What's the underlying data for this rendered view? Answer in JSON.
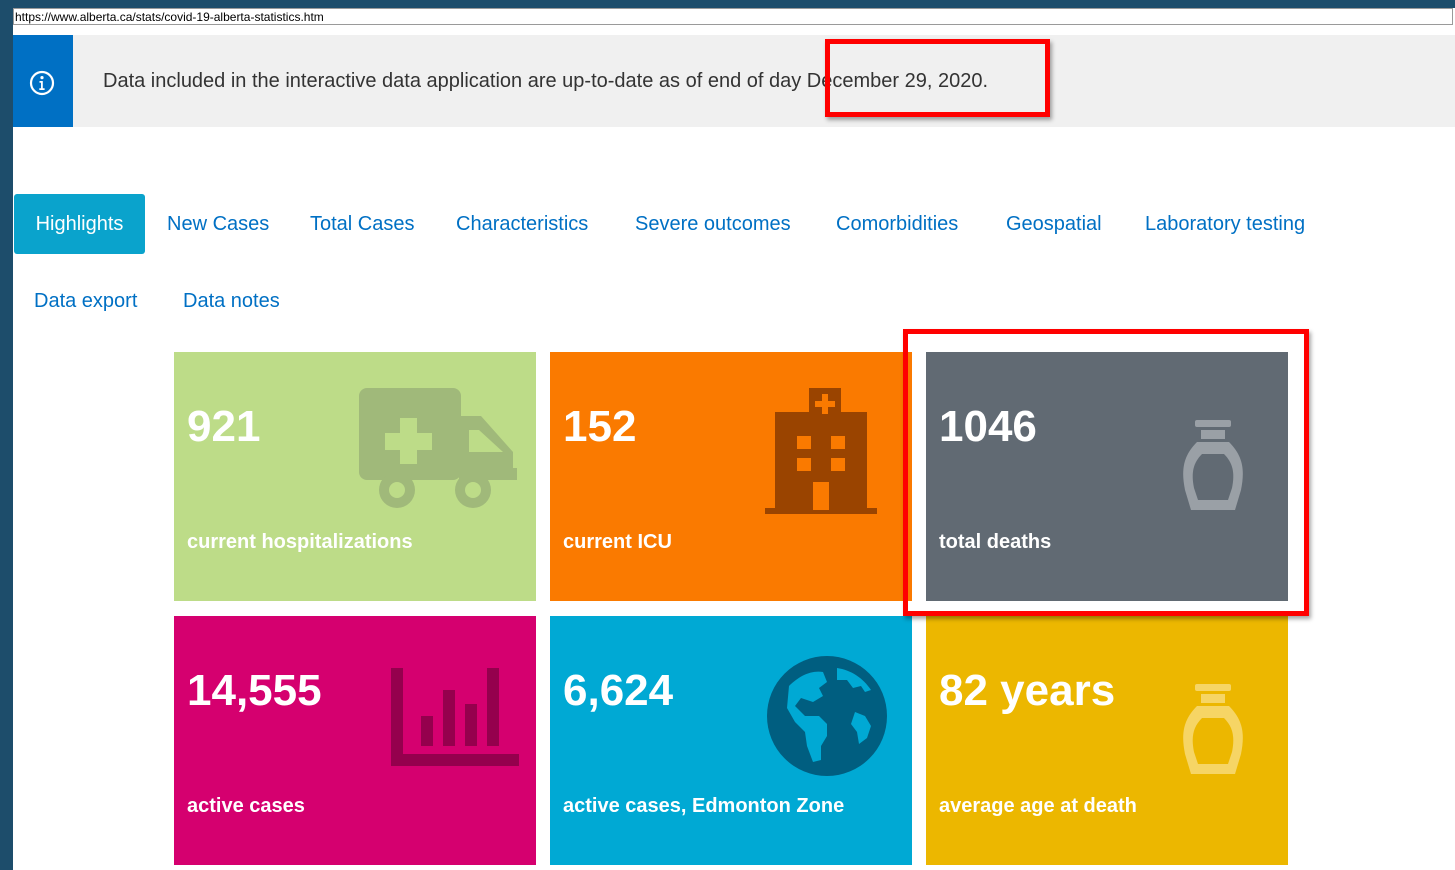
{
  "browser": {
    "url": "https://www.alberta.ca/stats/covid-19-alberta-statistics.htm"
  },
  "notice": {
    "icon": "info-icon",
    "text": "Data included in the interactive data application are up-to-date as of end of day December 29, 2020."
  },
  "tabs": [
    {
      "label": "Highlights",
      "active": true
    },
    {
      "label": "New Cases"
    },
    {
      "label": "Total Cases"
    },
    {
      "label": "Characteristics"
    },
    {
      "label": "Severe outcomes"
    },
    {
      "label": "Comorbidities"
    },
    {
      "label": "Geospatial"
    },
    {
      "label": "Laboratory testing"
    },
    {
      "label": "Data export"
    },
    {
      "label": "Data notes"
    }
  ],
  "tiles": [
    {
      "value": "921",
      "label": "current hospitalizations",
      "color": "#bddc88",
      "icon": "ambulance-icon"
    },
    {
      "value": "152",
      "label": "current ICU",
      "color": "#fa7a00",
      "icon": "hospital-icon"
    },
    {
      "value": "1046",
      "label": "total deaths",
      "color": "#616a73",
      "icon": "urn-icon"
    },
    {
      "value": "14,555",
      "label": "active cases",
      "color": "#d5006f",
      "icon": "bar-chart-icon"
    },
    {
      "value": "6,624",
      "label": "active cases, Edmonton Zone",
      "color": "#00a9d4",
      "icon": "globe-icon"
    },
    {
      "value": "82 years",
      "label": "average age at death",
      "color": "#ecb700",
      "icon": "urn-icon"
    }
  ],
  "annotation_color": "#ff0000"
}
